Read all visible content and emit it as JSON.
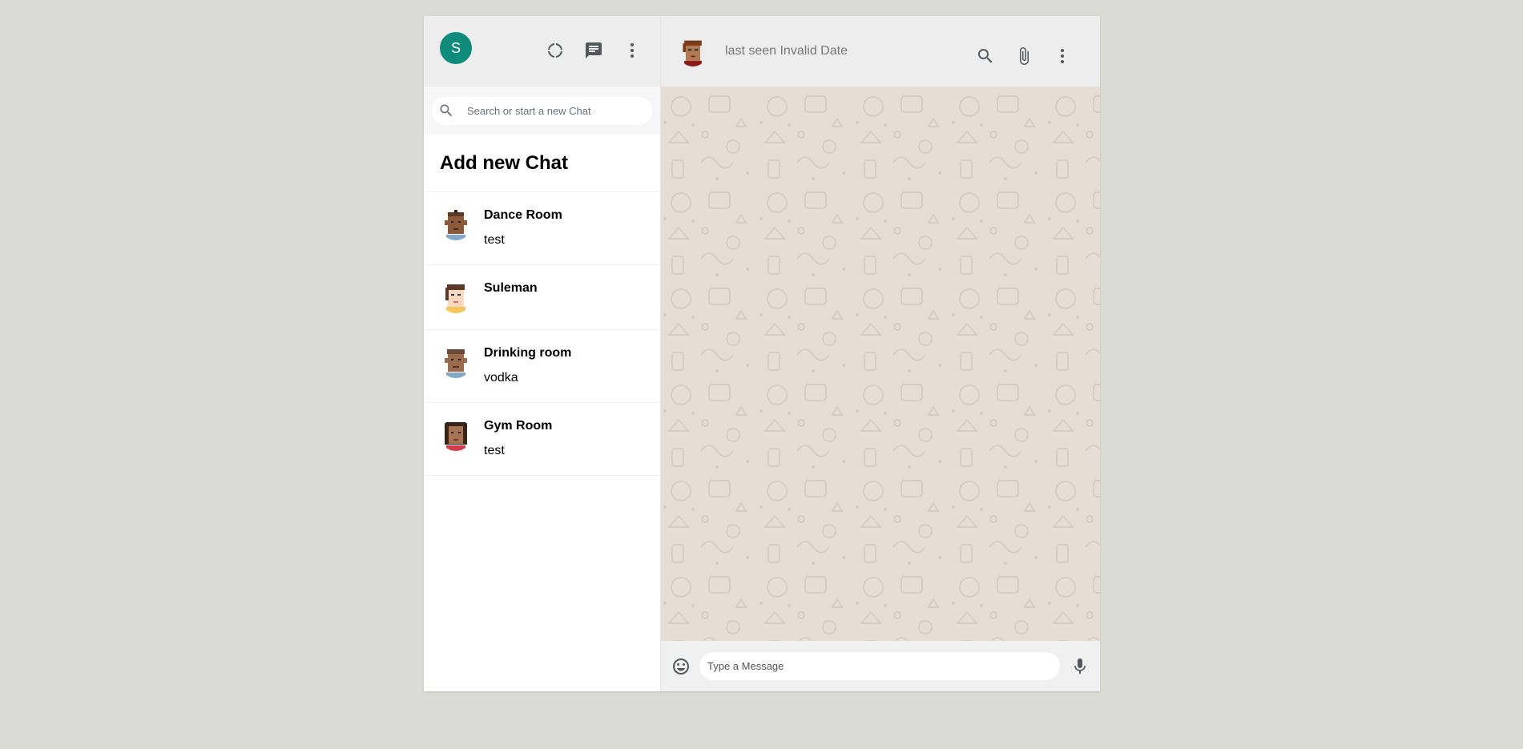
{
  "user": {
    "initial": "S",
    "avatar_color": "#0e8b7a"
  },
  "header_icons": [
    "status-icon",
    "new-chat-icon",
    "menu-icon"
  ],
  "search": {
    "placeholder": "Search or start a new Chat"
  },
  "add_chat_label": "Add new Chat",
  "chats": [
    {
      "name": "Dance Room",
      "last_message": "test"
    },
    {
      "name": "Suleman",
      "last_message": ""
    },
    {
      "name": "Drinking room",
      "last_message": "vodka"
    },
    {
      "name": "Gym Room",
      "last_message": "test"
    }
  ],
  "chat_header": {
    "last_seen": "last seen Invalid Date",
    "icons": [
      "search-icon",
      "attach-icon",
      "menu-icon"
    ]
  },
  "footer": {
    "placeholder": "Type a Message",
    "icons": [
      "emoji-icon",
      "mic-icon"
    ]
  },
  "colors": {
    "background": "#dadbd3",
    "header": "#ededed",
    "chat_wallpaper": "#e6ded5",
    "accent": "#0e8b7a"
  }
}
